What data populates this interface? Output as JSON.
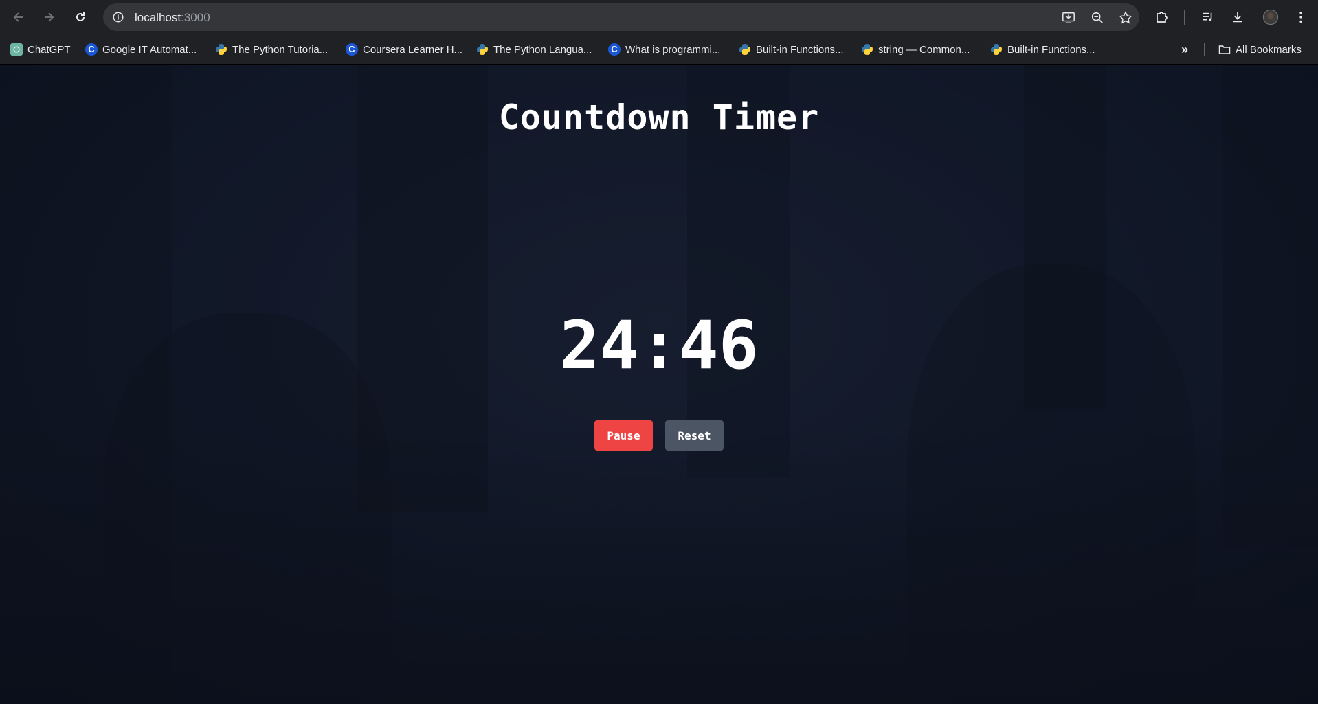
{
  "browser": {
    "url_host": "localhost",
    "url_port": ":3000",
    "bookmarks": [
      {
        "label": "ChatGPT",
        "icon": "chatgpt-icon"
      },
      {
        "label": "Google IT Automat...",
        "icon": "coursera-icon"
      },
      {
        "label": "The Python Tutoria...",
        "icon": "python-icon"
      },
      {
        "label": "Coursera Learner H...",
        "icon": "coursera-icon"
      },
      {
        "label": "The Python Langua...",
        "icon": "python-icon"
      },
      {
        "label": "What is programmi...",
        "icon": "coursera-icon"
      },
      {
        "label": "Built-in Functions...",
        "icon": "python-icon"
      },
      {
        "label": "string — Common...",
        "icon": "python-icon"
      },
      {
        "label": "Built-in Functions...",
        "icon": "python-icon"
      }
    ],
    "all_bookmarks_label": "All Bookmarks"
  },
  "page": {
    "title": "Countdown Timer",
    "time": "24:46",
    "pause_label": "Pause",
    "reset_label": "Reset"
  },
  "colors": {
    "pause": "#ef4444",
    "reset": "#4b5563",
    "background": "#111827"
  }
}
